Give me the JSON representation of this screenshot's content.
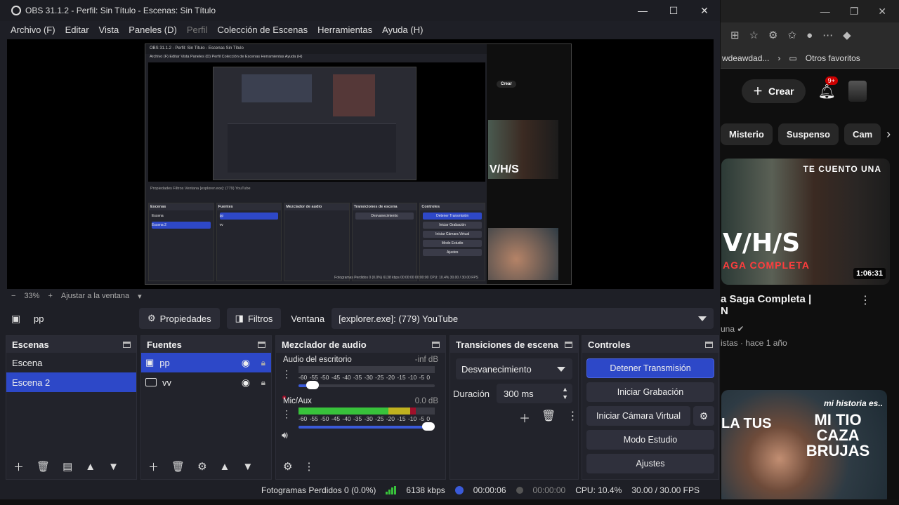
{
  "obs": {
    "title": "OBS 31.1.2 - Perfil: Sin Título - Escenas: Sin Título",
    "menu": [
      "Archivo (F)",
      "Editar",
      "Vista",
      "Paneles (D)",
      "Perfil",
      "Colección de Escenas",
      "Herramientas",
      "Ayuda (H)"
    ],
    "zoom": {
      "value": "33%",
      "fit_label": "Ajustar a la ventana"
    },
    "source_bar": {
      "source_name": "pp",
      "properties_label": "Propiedades",
      "filters_label": "Filtros",
      "window_label": "Ventana",
      "window_value": "[explorer.exe]: (779) YouTube"
    },
    "scenes": {
      "title": "Escenas",
      "items": [
        "Escena",
        "Escena 2"
      ],
      "selected": "Escena 2"
    },
    "sources": {
      "title": "Fuentes",
      "items": [
        "pp",
        "vv"
      ],
      "selected": "pp"
    },
    "mixer": {
      "title": "Mezclador de audio",
      "channels": [
        {
          "name": "Audio del escritorio",
          "level": "-inf dB",
          "meter_fraction": 0.0,
          "volume_fraction": 0.06
        },
        {
          "name": "Mic/Aux",
          "level": "0.0 dB",
          "meter_fraction": 0.86,
          "volume_fraction": 1.0
        }
      ],
      "ticks": [
        "-60",
        "-55",
        "-50",
        "-45",
        "-40",
        "-35",
        "-30",
        "-25",
        "-20",
        "-15",
        "-10",
        "-5",
        "0"
      ]
    },
    "transitions": {
      "title": "Transiciones de escena",
      "type": "Desvanecimiento",
      "duration_label": "Duración",
      "duration_value": "300 ms"
    },
    "controls": {
      "title": "Controles",
      "stop_stream": "Detener Transmisión",
      "start_recording": "Iniciar Grabación",
      "start_virtual_cam": "Iniciar Cámara Virtual",
      "studio_mode": "Modo Estudio",
      "settings": "Ajustes"
    },
    "status": {
      "dropped_frames": "Fotogramas Perdidos 0 (0.0%)",
      "bitrate": "6138 kbps",
      "stream_time": "00:00:06",
      "rec_time": "00:00:00",
      "cpu": "CPU: 10.4%",
      "fps": "30.00 / 30.00 FPS"
    },
    "nested": {
      "title": "OBS 31.1.2 - Perfil: Sin Título - Escenas Sin Título",
      "menu": "Archivo (F)   Editar   Vista   Paneles (D)   Perfil   Colección de Escenas   Herramientas   Ayuda (H)",
      "bar": "Propiedades   Filtros   Ventana   [explorer.exe]: (779) YouTube",
      "status": "Fotogramas Perdidos 0 (0.0%)   6138 kbps   00:00:00   00:00:00   CPU: 10.4%   30.00 / 30.00 FPS",
      "docks": [
        "Escenas",
        "Fuentes",
        "Mezclador de audio",
        "Transiciones de escena",
        "Controles"
      ]
    }
  },
  "browser": {
    "favorites_left": "wdeawdad...",
    "favorites_right": "Otros favoritos",
    "create_label": "Crear",
    "notif_badge": "9+",
    "chips": [
      "Misterio",
      "Suspenso",
      "Cam"
    ],
    "video1": {
      "top_text": "TE CUENTO UNA",
      "big_text": "V/H/S",
      "sub_text": "AGA COMPLETA",
      "duration": "1:06:31",
      "title": "a Saga Completa |",
      "title2": "N",
      "meta1": "una",
      "meta2": "istas · hace 1 año"
    },
    "video2": {
      "line1": "mi historia es..",
      "line2": "MI TIO CAZA BRUJAS",
      "left_text": "LA TUS"
    }
  }
}
